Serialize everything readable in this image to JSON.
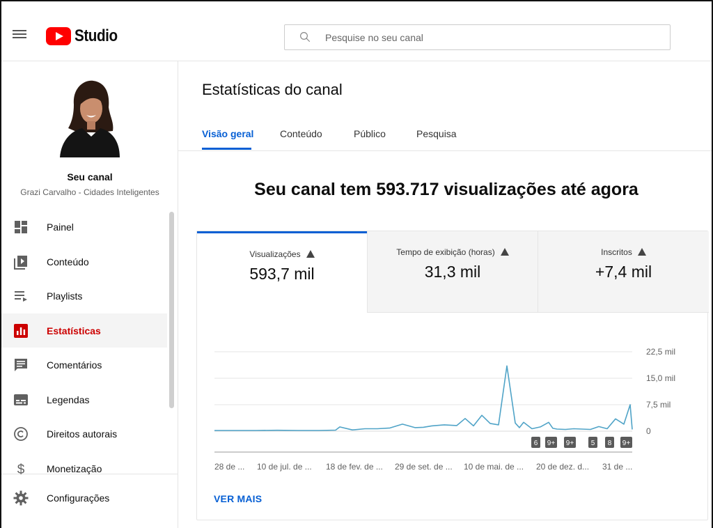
{
  "header": {
    "logo_text": "Studio",
    "search_placeholder": "Pesquise no seu canal"
  },
  "sidebar": {
    "channel_label": "Seu canal",
    "channel_name": "Grazi Carvalho - Cidades Inteligentes",
    "items": [
      {
        "label": "Painel",
        "icon": "dashboard-icon"
      },
      {
        "label": "Conteúdo",
        "icon": "content-icon"
      },
      {
        "label": "Playlists",
        "icon": "playlist-icon"
      },
      {
        "label": "Estatísticas",
        "icon": "analytics-icon"
      },
      {
        "label": "Comentários",
        "icon": "comments-icon"
      },
      {
        "label": "Legendas",
        "icon": "subtitles-icon"
      },
      {
        "label": "Direitos autorais",
        "icon": "copyright-icon"
      },
      {
        "label": "Monetização",
        "icon": "dollar-icon"
      },
      {
        "label": "Configurações",
        "icon": "gear-icon"
      }
    ]
  },
  "main": {
    "page_title": "Estatísticas do canal",
    "tabs": [
      "Visão geral",
      "Conteúdo",
      "Público",
      "Pesquisa"
    ],
    "headline": "Seu canal tem 593.717 visualizações até agora",
    "metrics": [
      {
        "label": "Visualizações",
        "value": "593,7 mil"
      },
      {
        "label": "Tempo de exibição (horas)",
        "value": "31,3 mil"
      },
      {
        "label": "Inscritos",
        "value": "+7,4 mil"
      }
    ],
    "ver_mais": "VER MAIS"
  },
  "colors": {
    "accent": "#065fd4",
    "active_nav": "#cc0000",
    "chart_line": "#4fa3c7",
    "logo_red": "#ff0000"
  },
  "chart_data": {
    "type": "line",
    "y_ticks": [
      "22,5 mil",
      "15,0 mil",
      "7,5 mil",
      "0"
    ],
    "y_tick_values": [
      22500,
      15000,
      7500,
      0
    ],
    "ylim": [
      0,
      22500
    ],
    "x_tick_labels": [
      "28 de ...",
      "10 de jul. de ...",
      "18 de fev. de ...",
      "29 de set. de ...",
      "10 de mai. de ...",
      "20 de dez. d...",
      "31 de ..."
    ],
    "series": [
      {
        "x": [
          0,
          0.05,
          0.1,
          0.15,
          0.2,
          0.25,
          0.29,
          0.3,
          0.33,
          0.36,
          0.39,
          0.42,
          0.45,
          0.48,
          0.5,
          0.52,
          0.55,
          0.58,
          0.6,
          0.62,
          0.64,
          0.66,
          0.68,
          0.7,
          0.72,
          0.73,
          0.74,
          0.76,
          0.78,
          0.8,
          0.81,
          0.82,
          0.84,
          0.86,
          0.88,
          0.9,
          0.92,
          0.94,
          0.96,
          0.98,
          0.995,
          1.0
        ],
        "values": [
          200,
          200,
          200,
          250,
          200,
          200,
          300,
          1200,
          350,
          700,
          700,
          900,
          2000,
          1000,
          1100,
          1500,
          1800,
          1600,
          3600,
          1500,
          4500,
          2200,
          1800,
          18500,
          2300,
          1000,
          2500,
          700,
          1200,
          2500,
          800,
          600,
          500,
          700,
          600,
          500,
          1300,
          700,
          3500,
          2000,
          7500,
          500
        ]
      }
    ],
    "annotations": [
      "6",
      "9+",
      "9+",
      "5",
      "8",
      "9+"
    ],
    "grid": true
  }
}
